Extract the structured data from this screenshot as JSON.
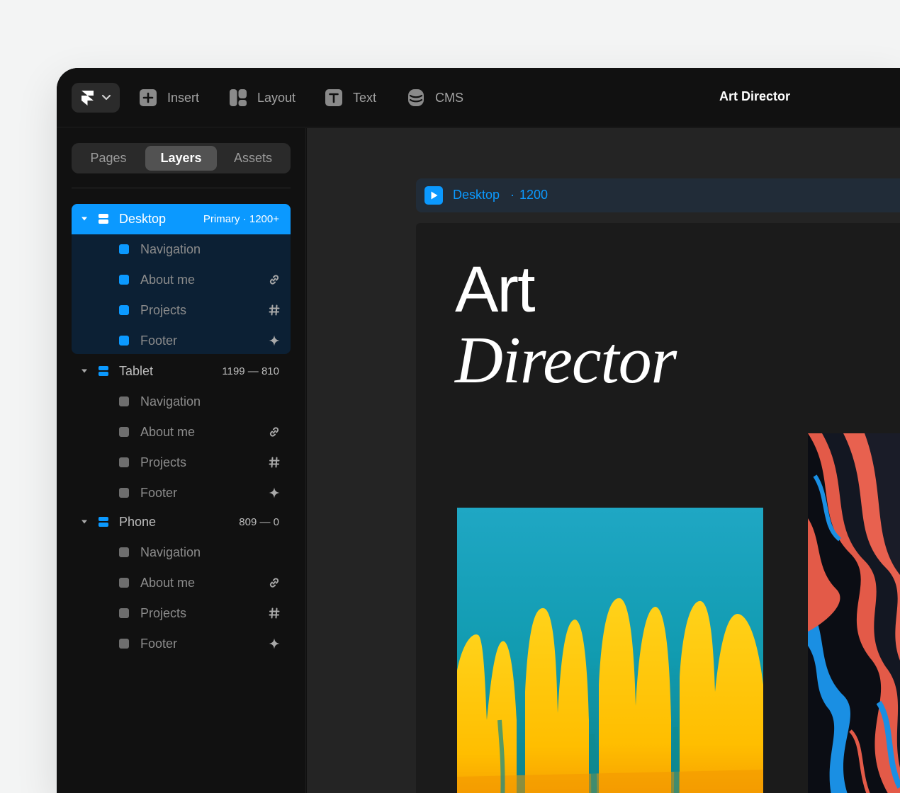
{
  "toolbar": {
    "menu": [
      {
        "label": "Insert",
        "icon": "plus-icon"
      },
      {
        "label": "Layout",
        "icon": "layout-icon"
      },
      {
        "label": "Text",
        "icon": "text-icon"
      },
      {
        "label": "CMS",
        "icon": "database-icon"
      }
    ],
    "document_title": "Art Director"
  },
  "sidebar": {
    "tabs": [
      {
        "label": "Pages",
        "active": false
      },
      {
        "label": "Layers",
        "active": true
      },
      {
        "label": "Assets",
        "active": false
      }
    ],
    "breakpoints": [
      {
        "label": "Desktop",
        "meta": "Primary · 1200+",
        "selected": true,
        "children": [
          {
            "label": "Navigation",
            "icon": ""
          },
          {
            "label": "About me",
            "icon": "link-icon"
          },
          {
            "label": "Projects",
            "icon": "hash-icon"
          },
          {
            "label": "Footer",
            "icon": "sparkle-icon"
          }
        ]
      },
      {
        "label": "Tablet",
        "meta": "1199 — 810",
        "selected": false,
        "children": [
          {
            "label": "Navigation",
            "icon": ""
          },
          {
            "label": "About me",
            "icon": "link-icon"
          },
          {
            "label": "Projects",
            "icon": "hash-icon"
          },
          {
            "label": "Footer",
            "icon": "sparkle-icon"
          }
        ]
      },
      {
        "label": "Phone",
        "meta": "809 — 0",
        "selected": false,
        "children": [
          {
            "label": "Navigation",
            "icon": ""
          },
          {
            "label": "About me",
            "icon": "link-icon"
          },
          {
            "label": "Projects",
            "icon": "hash-icon"
          },
          {
            "label": "Footer",
            "icon": "sparkle-icon"
          }
        ]
      }
    ]
  },
  "canvas": {
    "frame_label": {
      "name": "Desktop",
      "separator": "·",
      "size": "1200"
    },
    "hero": {
      "line1": "Art",
      "line2": "Director"
    }
  },
  "colors": {
    "accent": "#0b99ff",
    "window_bg": "#111111",
    "canvas_bg": "#242424",
    "page_bg": "#1b1b1b"
  }
}
